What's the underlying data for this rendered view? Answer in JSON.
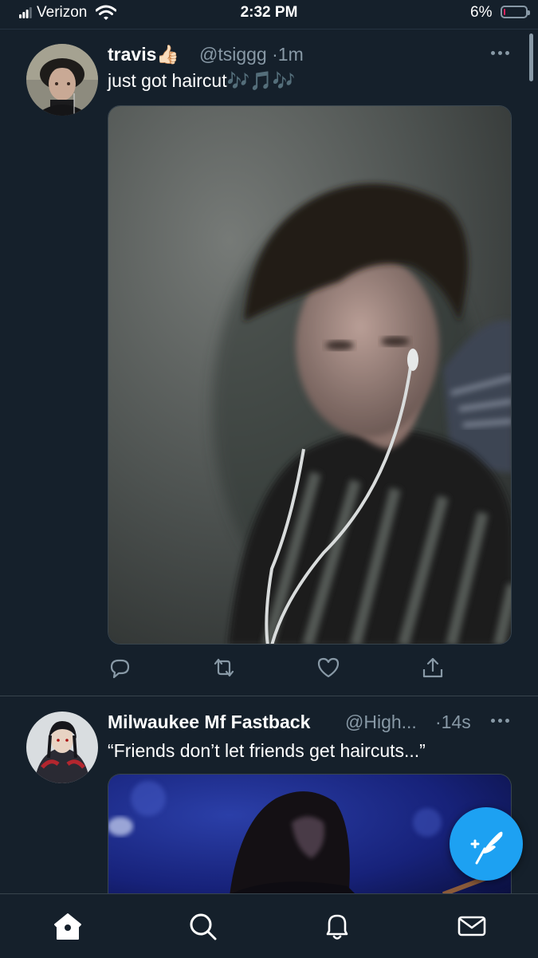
{
  "status_bar": {
    "carrier": "Verizon",
    "time": "2:32 PM",
    "battery_percent": "6%",
    "battery_level": 0.06,
    "battery_color": "#e0245e"
  },
  "tweets": [
    {
      "display_name": "travis",
      "emoji": "👍🏻",
      "handle": "@tsiggg",
      "separator": "·",
      "time": "1m",
      "text": "just got   haircut🎶🎵🎶"
    },
    {
      "display_name": "Milwaukee Mf Fastback",
      "handle": "@High...",
      "separator": "·",
      "time": "14s",
      "text": "“Friends don’t let friends get haircuts...”"
    }
  ],
  "icons": {
    "actions": [
      "reply-icon",
      "retweet-icon",
      "like-icon",
      "share-icon"
    ],
    "tabs": [
      "home-icon",
      "search-icon",
      "notifications-icon",
      "messages-icon"
    ],
    "fab": "compose-tweet-icon"
  },
  "colors": {
    "background": "#15202b",
    "accent": "#1da1f2",
    "secondary_text": "#8899a6",
    "divider": "#38444d"
  }
}
